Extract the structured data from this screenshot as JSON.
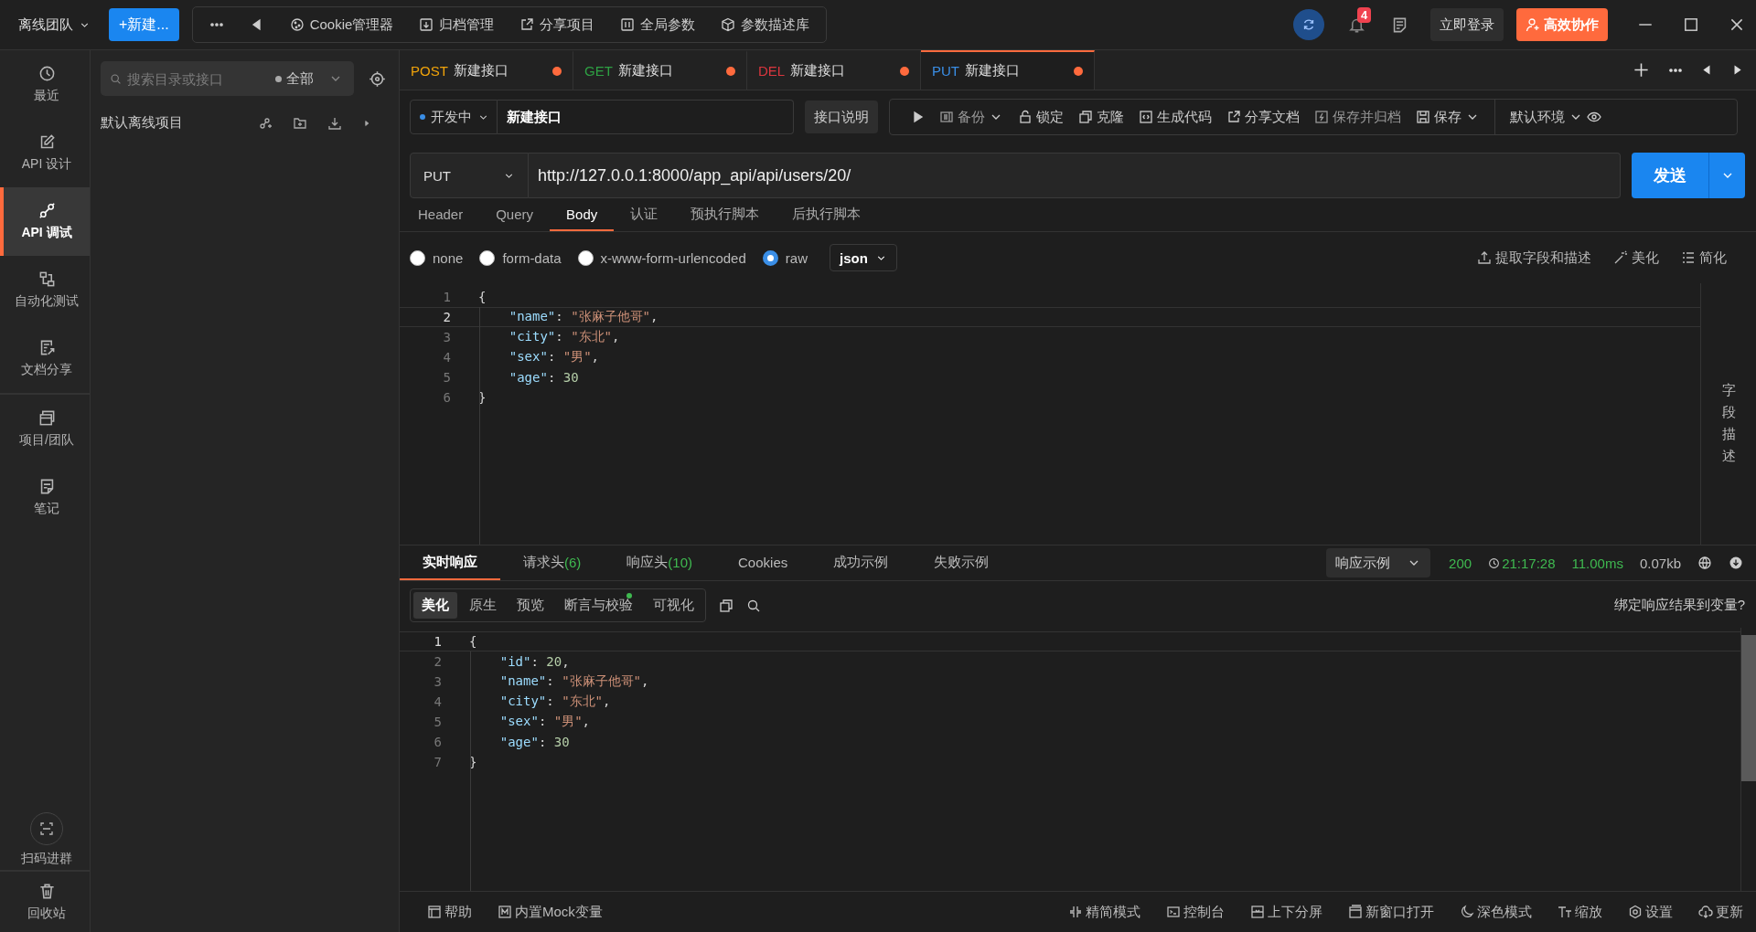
{
  "team_menu": "离线团队",
  "new_button": "+新建...",
  "top_toolbar": [
    "Cookie管理器",
    "归档管理",
    "分享项目",
    "全局参数",
    "参数描述库"
  ],
  "notification_count": "4",
  "login_button": "立即登录",
  "collab_button": "高效协作",
  "nav": [
    {
      "label": "最近",
      "selected": false
    },
    {
      "label": "API 设计",
      "selected": false
    },
    {
      "label": "API 调试",
      "selected": true
    },
    {
      "label": "自动化测试",
      "selected": false
    },
    {
      "label": "文档分享",
      "selected": false
    },
    {
      "label": "项目/团队",
      "selected": false
    },
    {
      "label": "笔记",
      "selected": false
    }
  ],
  "nav_bottom": [
    "扫码进群",
    "回收站"
  ],
  "tree": {
    "search_placeholder": "搜索目录或接口",
    "filter": "全部",
    "project": "默认离线项目"
  },
  "tabs": [
    {
      "method": "POST",
      "color": "#f0a30a",
      "name": "新建接口",
      "modified": true,
      "selected": false
    },
    {
      "method": "GET",
      "color": "#2ea043",
      "name": "新建接口",
      "modified": true,
      "selected": false
    },
    {
      "method": "DEL",
      "color": "#d9363e",
      "name": "新建接口",
      "modified": true,
      "selected": false
    },
    {
      "method": "PUT",
      "color": "#3a8ee6",
      "name": "新建接口",
      "modified": true,
      "selected": true
    }
  ],
  "request": {
    "status": "开发中",
    "name": "新建接口",
    "doc_button": "接口说明",
    "actions": [
      "备份",
      "锁定",
      "克隆",
      "生成代码",
      "分享文档",
      "保存并归档",
      "保存"
    ],
    "environment": "默认环境",
    "method": "PUT",
    "url": "http://127.0.0.1:8000/app_api/api/users/20/",
    "send": "发送"
  },
  "request_tabs": [
    {
      "label": "Header",
      "selected": false
    },
    {
      "label": "Query",
      "selected": false
    },
    {
      "label": "Body",
      "selected": true
    },
    {
      "label": "认证",
      "selected": false
    },
    {
      "label": "预执行脚本",
      "selected": false
    },
    {
      "label": "后执行脚本",
      "selected": false
    }
  ],
  "body_types": [
    {
      "label": "none",
      "selected": false
    },
    {
      "label": "form-data",
      "selected": false
    },
    {
      "label": "x-www-form-urlencoded",
      "selected": false
    },
    {
      "label": "raw",
      "selected": true
    }
  ],
  "raw_format": "json",
  "body_tools": [
    "提取字段和描述",
    "美化",
    "简化"
  ],
  "request_body": [
    {
      "no": "1",
      "text": "{",
      "current": false
    },
    {
      "no": "2",
      "text": "    \"name\": \"张麻子他哥\",",
      "current": true
    },
    {
      "no": "3",
      "text": "    \"city\": \"东北\",",
      "current": false
    },
    {
      "no": "4",
      "text": "    \"sex\": \"男\",",
      "current": false
    },
    {
      "no": "5",
      "text": "    \"age\": 30",
      "current": false
    },
    {
      "no": "6",
      "text": "}",
      "current": false
    }
  ],
  "side_panel": "字段描述",
  "response": {
    "tabs": [
      {
        "label": "实时响应",
        "selected": true
      },
      {
        "label": "请求头",
        "count": "(6)",
        "selected": false
      },
      {
        "label": "响应头",
        "count": "(10)",
        "selected": false
      },
      {
        "label": "Cookies",
        "selected": false
      },
      {
        "label": "成功示例",
        "selected": false
      },
      {
        "label": "失败示例",
        "selected": false
      }
    ],
    "example_select": "响应示例",
    "status": "200",
    "time": "21:17:28",
    "duration": "11.00ms",
    "size": "0.07kb",
    "view_tabs": [
      {
        "label": "美化",
        "selected": true,
        "dot": false
      },
      {
        "label": "原生",
        "selected": false,
        "dot": false
      },
      {
        "label": "预览",
        "selected": false,
        "dot": false
      },
      {
        "label": "断言与校验",
        "selected": false,
        "dot": true
      },
      {
        "label": "可视化",
        "selected": false,
        "dot": false
      }
    ],
    "bind_link": "绑定响应结果到变量?",
    "body": [
      {
        "no": "1",
        "text": "{",
        "current": true
      },
      {
        "no": "2",
        "text": "    \"id\": 20,",
        "current": false
      },
      {
        "no": "3",
        "text": "    \"name\": \"张麻子他哥\",",
        "current": false
      },
      {
        "no": "4",
        "text": "    \"city\": \"东北\",",
        "current": false
      },
      {
        "no": "5",
        "text": "    \"sex\": \"男\",",
        "current": false
      },
      {
        "no": "6",
        "text": "    \"age\": 30",
        "current": false
      },
      {
        "no": "7",
        "text": "}",
        "current": false
      }
    ]
  },
  "footer_left": [
    "帮助",
    "内置Mock变量"
  ],
  "footer_right": [
    "精简模式",
    "控制台",
    "上下分屏",
    "新窗口打开",
    "深色模式",
    "缩放",
    "设置",
    "更新"
  ]
}
